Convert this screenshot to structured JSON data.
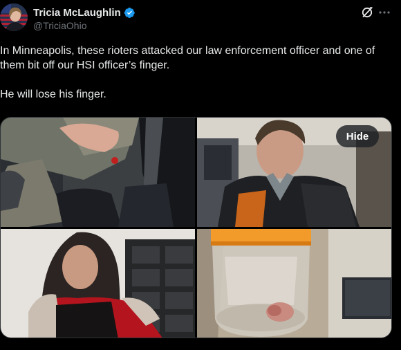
{
  "author": {
    "display_name": "Tricia McLaughlin",
    "handle": "@TriciaOhio",
    "verified": true,
    "avatar_icon": "profile-photo-flag"
  },
  "header_actions": {
    "grok_icon": "grok-slash-circle-icon",
    "more_icon": "more-dots-icon"
  },
  "post": {
    "paragraph1": "In Minneapolis, these rioters attacked our law enforcement officer and one of them bit off our HSI officer’s finger.",
    "paragraph2": "He will lose his finger."
  },
  "media": {
    "count": 4,
    "hide_label": "Hide"
  },
  "colors": {
    "background": "#000000",
    "text": "#e7e9ea",
    "secondary_text": "#71767b",
    "verified_badge": "#1d9bf0",
    "border": "#2f3336"
  }
}
